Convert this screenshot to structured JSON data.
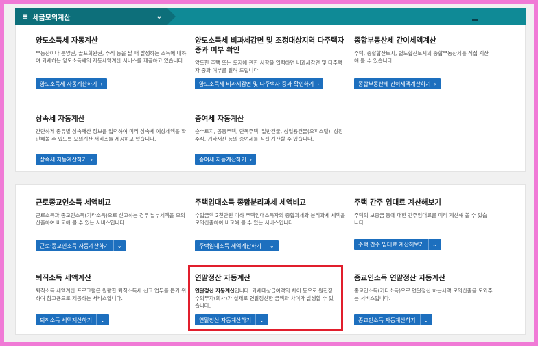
{
  "topbar": {
    "menu_label": "세금모의계산",
    "menu_icon": "≡",
    "chevron": "⌄"
  },
  "panel1": [
    {
      "title": "양도소득세 자동계산",
      "desc": "부동산이나 분양권, 골프회원권, 주식 등을 팔 때 발생하는 소득에 대하여 과세하는 양도소득세의 자동세액계산 서비스를 제공하고 있습니다.",
      "button": "양도소득세 자동계산하기"
    },
    {
      "title": "양도소득세 비과세감면 및 조정대상지역 다주택자 중과 여부 확인",
      "desc": "양도한 주택 또는 토지에 관한 사항을 입력하면 비과세감면 및 다주택자 중과 여부를 알려 드립니다.",
      "button": "양도소득세 비과세감면 및 다주택자 중과 확인하기"
    },
    {
      "title": "종합부동산세 간이세액계산",
      "desc": "주택, 종합합산토지, 별도합산토지의 종합부동산세를 직접 계산해 볼 수 있습니다.",
      "button": "종합부동산세 간이세액계산하기"
    },
    {
      "title": "상속세 자동계산",
      "desc": "간단하게 종류별 상속재산 정보를 입력하여 미리 상속세 예상세액을 확인해볼 수 있도록 모의계산 서비스를 제공하고 있습니다.",
      "button": "상속세 자동계산하기"
    },
    {
      "title": "증여세 자동계산",
      "desc": "순수토지, 공동주택, 단독주택, 일반건물, 상업용건물(오피스텔), 상장주식, 기타재산 등의 증여세를 직접 계산할 수 있습니다.",
      "button": "증여세 자동계산하기"
    }
  ],
  "panel2": [
    {
      "title": "근로종교인소득 세액비교",
      "desc": "근로소득과 종교인소득(기타소득)으로 신고하는 경우 납부세액을 모의산출하여 비교해 볼 수 있는 서비스입니다.",
      "button": "근로·종교인소득 자동계산하기"
    },
    {
      "title": "주택임대소득 종합분리과세 세액비교",
      "desc": "수입금액 2천만원 이하 주택임대소득자의 종합과세와 분리과세 세액을 모의산출하여 비교해 볼 수 있는 서비스입니다.",
      "button": "주택임대소득 세액계산하기"
    },
    {
      "title": "주택 간주 임대료 계산해보기",
      "desc": "주택의 보증금 등에 대한 간주임대료를 미리 계산해 볼 수 있습니다.",
      "button": "주택 간주 임대료 계산해보기"
    },
    {
      "title": "퇴직소득 세액계산",
      "desc": "퇴직소득 세액계산 프로그램은 원활한 퇴직소득세 신고 업무를 돕기 위하여 참고용으로 제공하는 서비스입니다.",
      "button": "퇴직소득 세액계산하기"
    },
    {
      "title": "연말정산 자동계산",
      "desc_bold": "연말정산 자동계산",
      "desc": "입니다. 과세대상급여액의 차이 등으로 원천징수의무자(회사)가 실제로 연말정산한 금액과 차이가 발생할 수 있습니다.",
      "button": "연말정산 자동계산하기"
    },
    {
      "title": "종교인소득 연말정산 자동계산",
      "desc": "종교인소득(기타소득)으로 연말정산 하는세액 모의산출을 도와주는 서비스입니다.",
      "button": "종교인소득 자동계산하기"
    }
  ],
  "icons": {
    "arrow_right": "›",
    "chevron_down": "⌄"
  }
}
